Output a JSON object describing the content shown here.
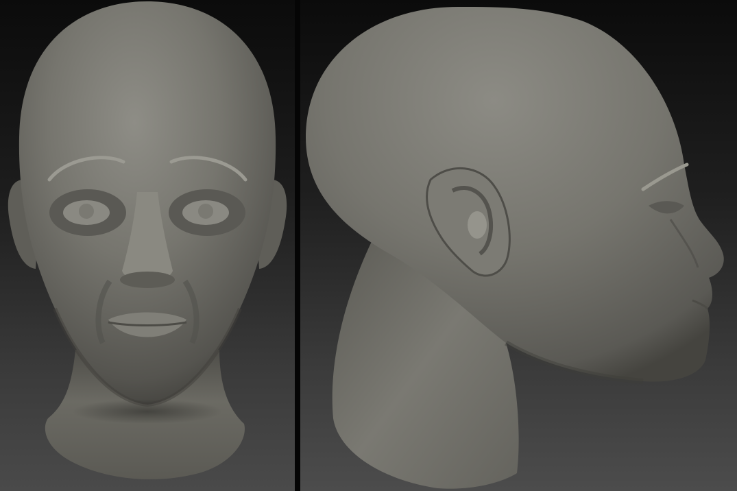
{
  "views": [
    {
      "name": "front-view"
    },
    {
      "name": "side-view"
    }
  ]
}
